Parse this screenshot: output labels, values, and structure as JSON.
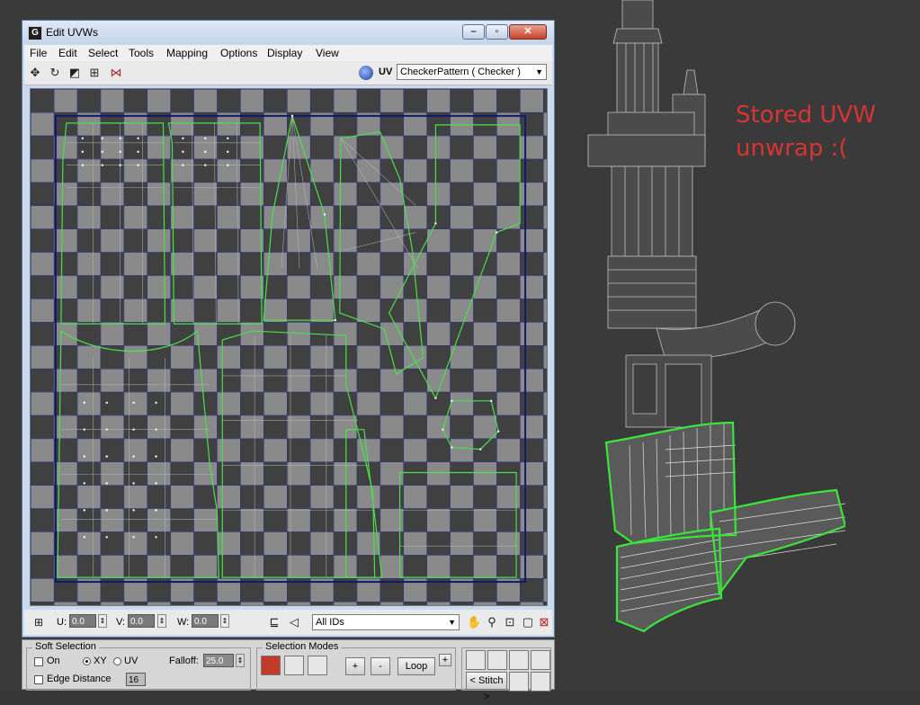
{
  "window": {
    "title": "Edit UVWs",
    "icon_letter": "G",
    "minimize_glyph": "–",
    "maximize_glyph": "▫",
    "close_glyph": "✕"
  },
  "menu": [
    "File",
    "Edit",
    "Select",
    "Tools",
    "Mapping",
    "Options",
    "Display",
    "View"
  ],
  "toolbar": {
    "uv_label": "UV",
    "texture_selected": "CheckerPattern  ( Checker )",
    "icons": [
      "move-icon",
      "rotate-icon",
      "scale-icon",
      "freeform-icon",
      "mirror-icon"
    ]
  },
  "bottom_toolbar": {
    "u_label": "U:",
    "u_value": "0.0",
    "v_label": "V:",
    "v_value": "0.0",
    "w_label": "W:",
    "w_value": "0.0",
    "ids_selected": "All IDs"
  },
  "rollout": {
    "soft_selection": {
      "title": "Soft Selection",
      "on_label": "On",
      "xy_label": "XY",
      "uv_label": "UV",
      "falloff_label": "Falloff:",
      "falloff_value": "25.0",
      "edge_distance_label": "Edge Distance",
      "edge_distance_value": "16"
    },
    "selection_modes": {
      "title": "Selection Modes",
      "loop_label": "Loop"
    },
    "stitch_label": "< Stitch >"
  },
  "annotation": "Stored UVW\nunwrap :(",
  "colors": {
    "checker_dark": "#404040",
    "checker_light": "#8a8a8a",
    "grid_line": "#1f2a8c",
    "uv_edge": "#49e24a",
    "uv_vertex": "#ffffff",
    "annotation": "#d93434"
  }
}
